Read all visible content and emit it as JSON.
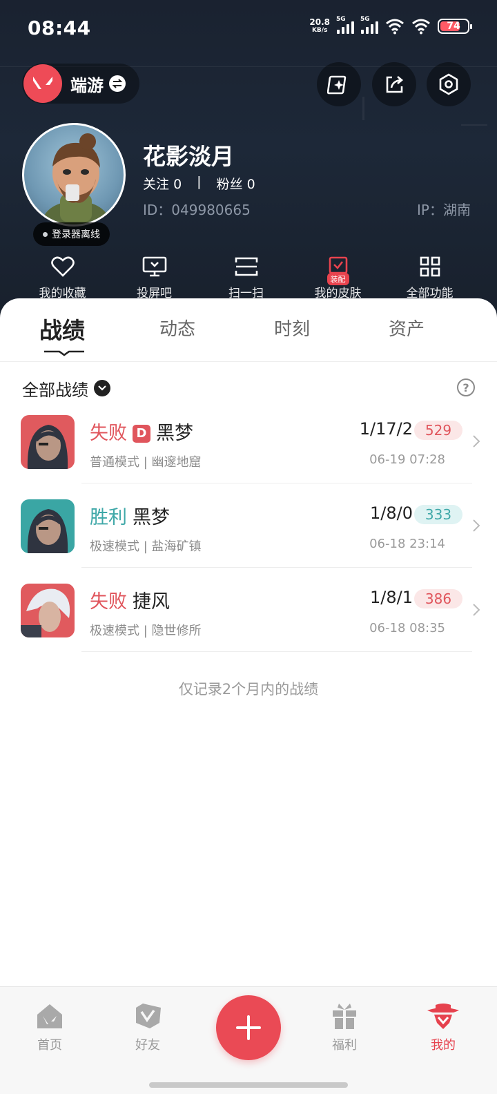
{
  "status": {
    "time": "08:44",
    "netspeed_value": "20.8",
    "netspeed_unit": "KB/s",
    "sim1": "5G",
    "sim2": "5G",
    "battery": "74"
  },
  "header": {
    "game_name": "端游",
    "username": "花影淡月",
    "follow_label": "关注",
    "follow_count": "0",
    "separator": "|",
    "fans_label": "粉丝",
    "fans_count": "0",
    "id_text": "ID：049980665",
    "ip_text": "IP：湖南",
    "offline_status": "登录器离线",
    "icons": [
      "ai-card-icon",
      "share-icon",
      "settings-icon"
    ]
  },
  "quick_menu": {
    "items": [
      {
        "label": "我的收藏",
        "icon": "heart-icon"
      },
      {
        "label": "投屏吧",
        "icon": "monitor-icon"
      },
      {
        "label": "扫一扫",
        "icon": "scan-icon"
      },
      {
        "label": "我的皮肤",
        "icon": "skin-icon",
        "badge": "装配"
      },
      {
        "label": "全部功能",
        "icon": "grid-icon"
      }
    ]
  },
  "tabs": {
    "items": [
      "战绩",
      "动态",
      "时刻",
      "资产"
    ],
    "active": "战绩"
  },
  "filter": {
    "label": "全部战绩"
  },
  "matches": [
    {
      "result": "失败",
      "badge": "D",
      "hero": "黑梦",
      "kda": "1/17/2",
      "score": "529",
      "mode": "普通模式 | 幽邃地窟",
      "time": "06-19 07:28"
    },
    {
      "result": "胜利",
      "badge": "",
      "hero": "黑梦",
      "kda": "1/8/0",
      "score": "333",
      "mode": "极速模式 | 盐海矿镇",
      "time": "06-18 23:14"
    },
    {
      "result": "失败",
      "badge": "",
      "hero": "捷风",
      "kda": "1/8/1",
      "score": "386",
      "mode": "极速模式 | 隐世修所",
      "time": "06-18 08:35"
    }
  ],
  "note": "仅记录2个月内的战绩",
  "bottom_nav": {
    "items": [
      "首页",
      "好友",
      "福利",
      "我的"
    ],
    "active": "我的"
  },
  "colors": {
    "accent": "#EA4A55",
    "win": "#3FA8A8",
    "lose": "#E0555C",
    "header_bg": "#1D2838"
  }
}
